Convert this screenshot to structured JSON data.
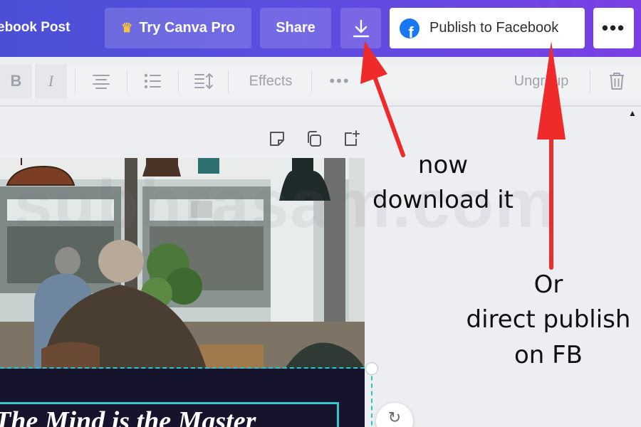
{
  "header": {
    "title": "ebook Post",
    "try_pro_label": "Try Canva Pro",
    "share_label": "Share",
    "publish_label": "Publish to Facebook",
    "more_label": "•••"
  },
  "toolbar": {
    "bold_label": "B",
    "italic_label": "I",
    "effects_label": "Effects",
    "more_label": "•••",
    "ungroup_label": "Ungroup"
  },
  "design": {
    "banner_text": "The Mind is the Master"
  },
  "watermark": "subhrasam.com",
  "annotations": {
    "download_line1": "now",
    "download_line2": "download it",
    "publish_line1": "Or",
    "publish_line2": "direct publish",
    "publish_line3": "on FB"
  },
  "colors": {
    "header_start": "#4b4fd6",
    "header_end": "#7b3fe4",
    "arrow": "#ee2a2a",
    "selection": "#27c6d5",
    "facebook": "#1877f2"
  }
}
